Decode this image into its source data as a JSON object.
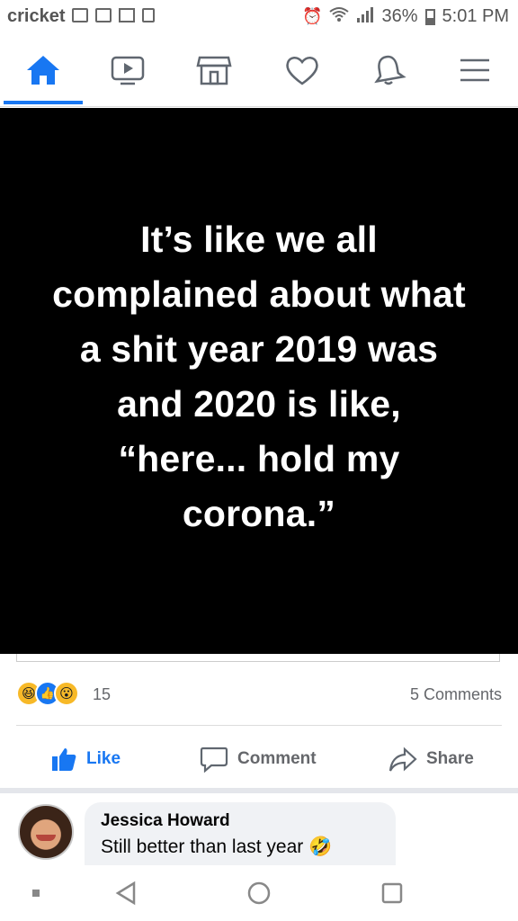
{
  "status_bar": {
    "carrier": "cricket",
    "battery_percent": "36%",
    "time": "5:01 PM"
  },
  "nav": {
    "active_tab": "home",
    "accent_color": "#1877f2",
    "icons": [
      "home-icon",
      "video-icon",
      "marketplace-icon",
      "dating-icon",
      "notifications-icon",
      "menu-icon"
    ]
  },
  "post": {
    "image_text": "It’s like we all\ncomplained about what\na shit year 2019 was\nand 2020 is like,\n“here... hold my\ncorona.”",
    "reactions": [
      "haha",
      "like",
      "wow"
    ],
    "reaction_count": "15",
    "comments_count": "5 Comments"
  },
  "actions": {
    "like": "Like",
    "comment": "Comment",
    "share": "Share"
  },
  "comment": {
    "author": "Jessica Howard",
    "text": "Still better than last year 🤣"
  }
}
